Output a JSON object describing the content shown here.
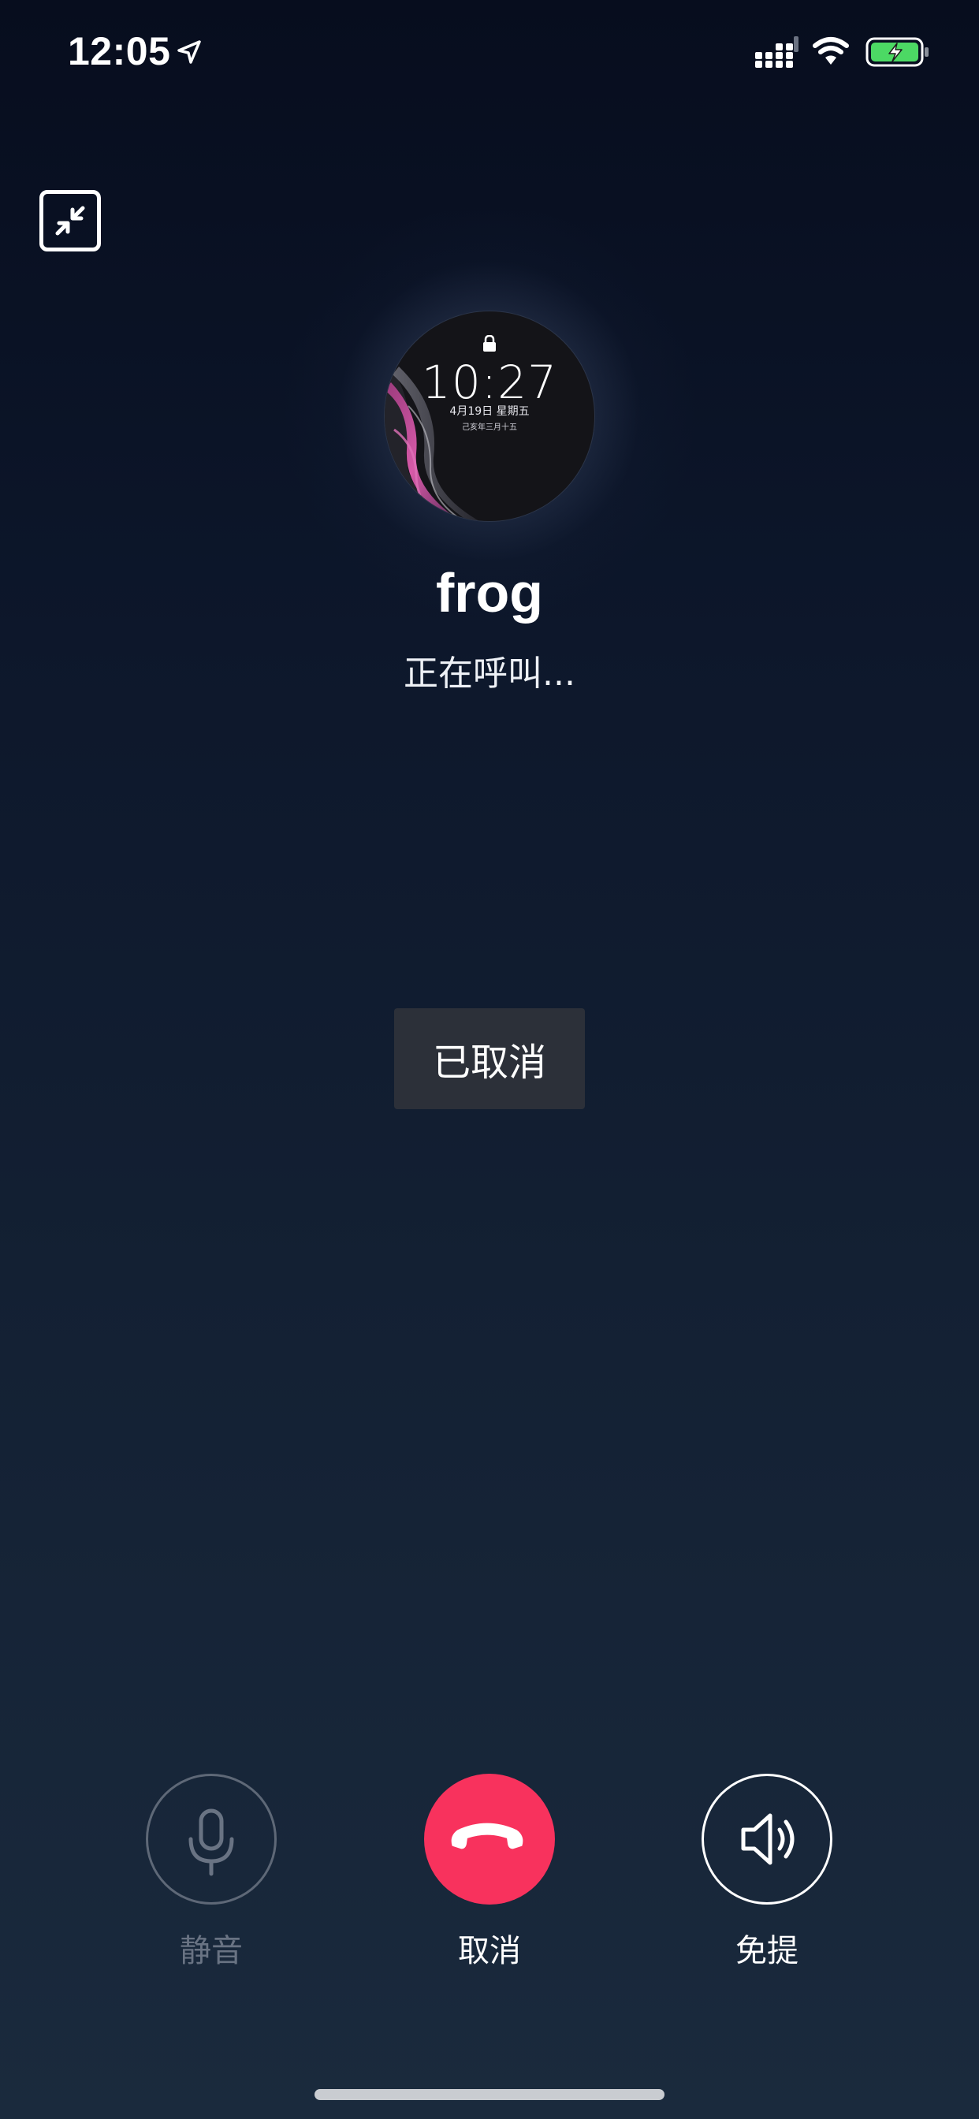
{
  "status_bar": {
    "time": "12:05",
    "location_icon": "location-arrow-icon",
    "signal_icon": "cellular-signal-icon",
    "wifi_icon": "wifi-icon",
    "battery_icon": "battery-charging-icon",
    "battery_color": "#4cd964"
  },
  "minimize": {
    "icon": "minimize-arrows-icon"
  },
  "avatar": {
    "lock_icon": "lock-icon",
    "time": "10:27",
    "date": "4月19日 星期五",
    "lunar_date": "己亥年三月十五"
  },
  "caller": {
    "name": "frog",
    "status": "正在呼叫..."
  },
  "toast": {
    "message": "已取消"
  },
  "controls": {
    "mute": {
      "label": "静音",
      "icon": "microphone-icon",
      "color": "#697383"
    },
    "cancel": {
      "label": "取消",
      "icon": "hang-up-phone-icon",
      "color": "#f8325d"
    },
    "speaker": {
      "label": "免提",
      "icon": "speaker-icon",
      "color": "#ffffff"
    }
  }
}
